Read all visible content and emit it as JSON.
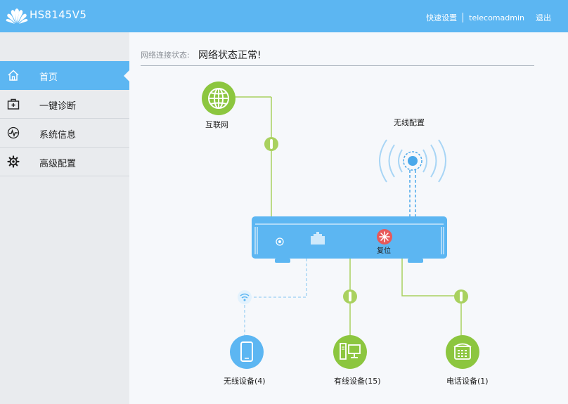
{
  "header": {
    "model": "HS8145V5",
    "quick_setup": "快速设置",
    "username": "telecomadmin",
    "logout": "退出"
  },
  "sidebar": {
    "items": [
      {
        "label": "首页",
        "icon": "home-icon",
        "active": true
      },
      {
        "label": "一键诊断",
        "icon": "medical-kit-icon",
        "active": false
      },
      {
        "label": "系统信息",
        "icon": "pulse-icon",
        "active": false
      },
      {
        "label": "高级配置",
        "icon": "gear-icon",
        "active": false
      }
    ]
  },
  "status": {
    "label": "网络连接状态:",
    "value": "网络状态正常!"
  },
  "diagram": {
    "internet_label": "互联网",
    "wireless_config_label": "无线配置",
    "reset_label": "复位",
    "wireless_devices_label": "无线设备(4)",
    "wired_devices_label": "有线设备(15)",
    "phone_devices_label": "电话设备(1)"
  },
  "colors": {
    "accent": "#5cb6f2",
    "green": "#8cc63f",
    "link_green": "#a9d15f",
    "wireless_blue": "#4aa8ea",
    "reset_red": "#e8595a"
  }
}
